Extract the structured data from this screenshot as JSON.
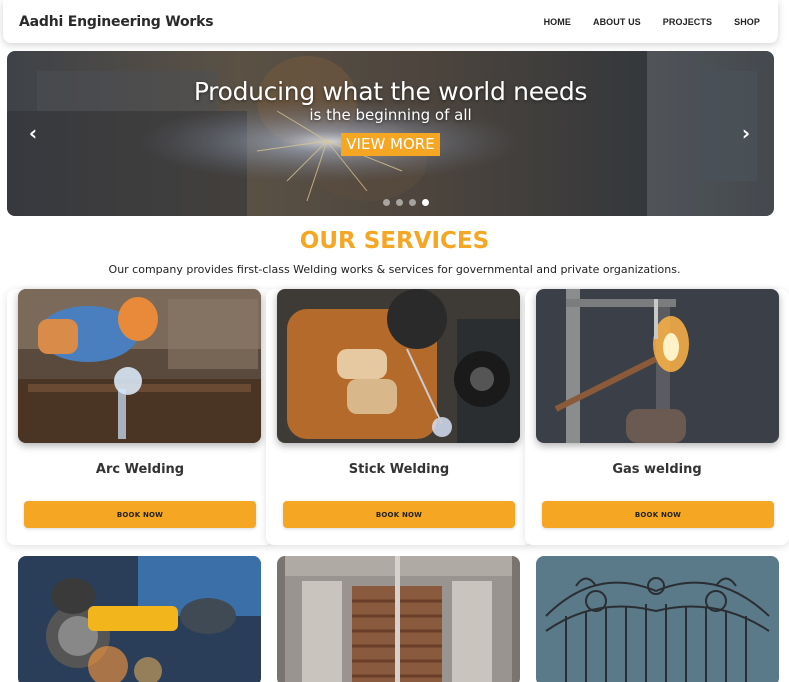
{
  "navbar": {
    "brand": "Aadhi Engineering Works",
    "links": [
      "HOME",
      "ABOUT US",
      "PROJECTS",
      "SHOP"
    ]
  },
  "carousel": {
    "title": "Producing what the world needs",
    "subtitle": "is the beginning of all",
    "button_label": "VIEW MORE",
    "prev_icon": "chevron-left-icon",
    "next_icon": "chevron-right-icon",
    "slide_count": 4,
    "active_slide": 4
  },
  "services": {
    "title": "OUR SERVICES",
    "description": "Our company provides first-class Welding works & services for governmental and private organizations.",
    "cards": [
      {
        "title": "Arc Welding",
        "button": "BOOK NOW"
      },
      {
        "title": "Stick Welding",
        "button": "BOOK NOW"
      },
      {
        "title": "Gas welding",
        "button": "BOOK NOW"
      }
    ]
  },
  "colors": {
    "accent": "#f5a623",
    "text": "#222222",
    "background": "#ffffff"
  }
}
